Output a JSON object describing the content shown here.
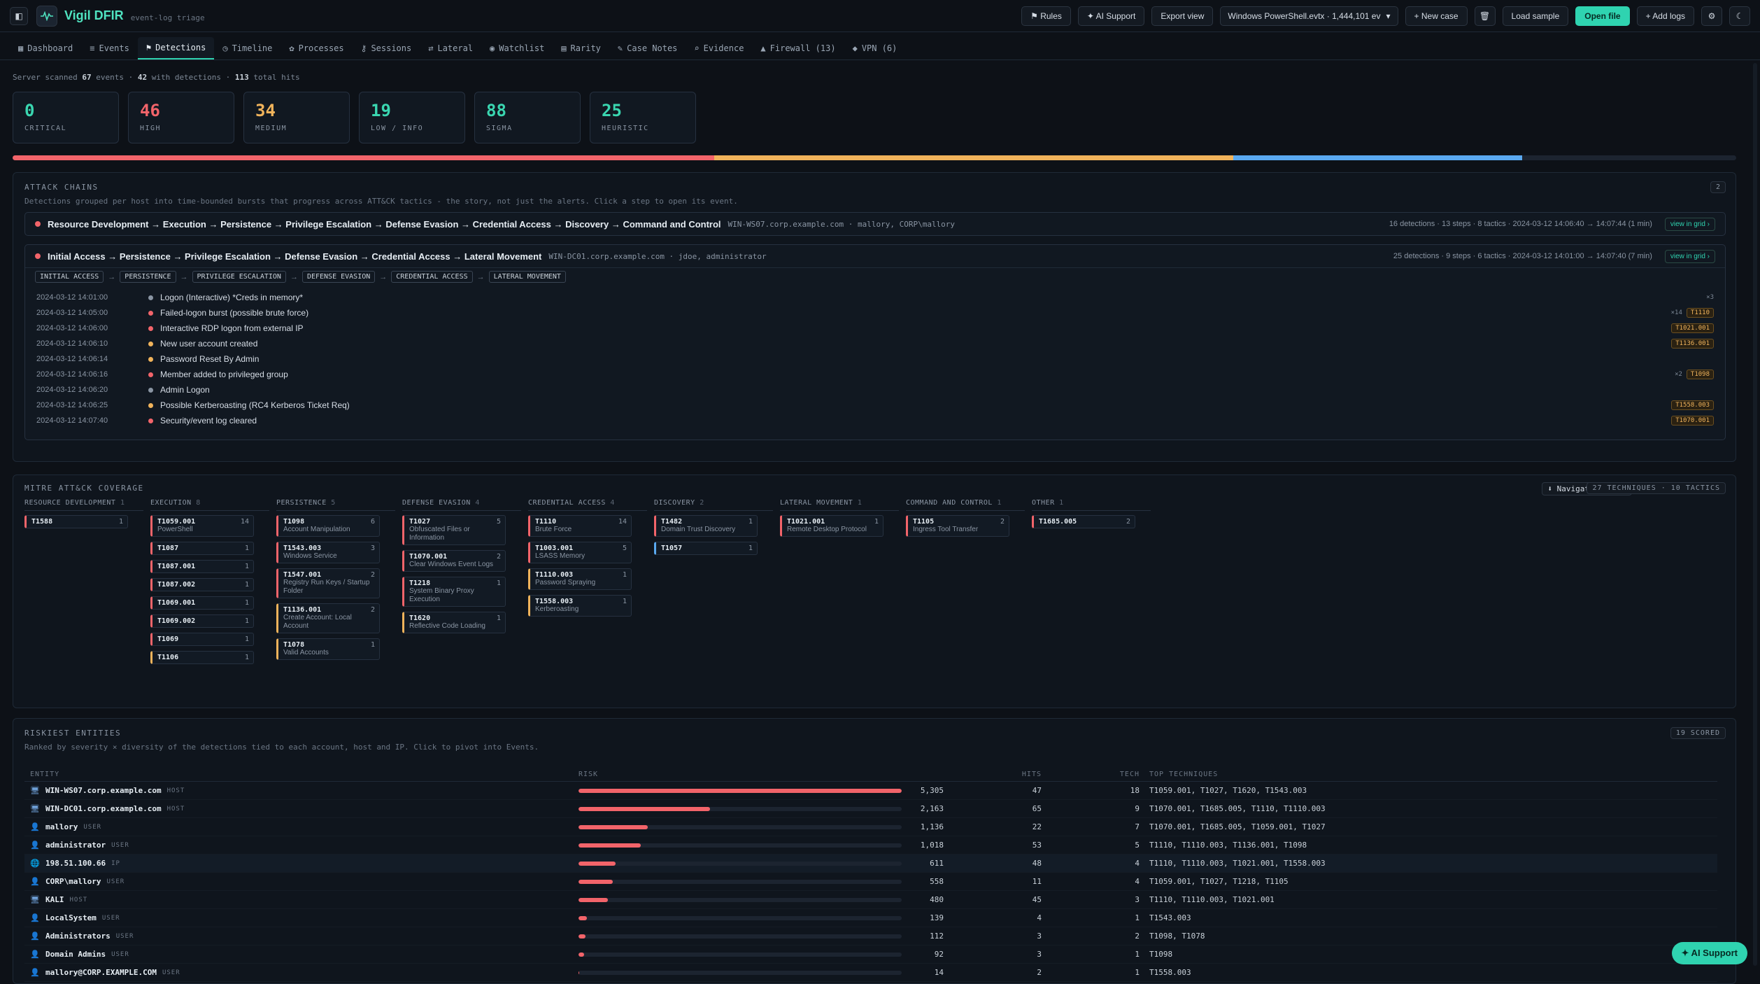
{
  "app": {
    "title": "Vigil DFIR",
    "subtitle": "event-log triage"
  },
  "toolbar": {
    "rules": "⚑ Rules",
    "ai_support": "✦ AI Support",
    "export": "Export view",
    "file": "Windows PowerShell.evtx · 1,444,101 ev",
    "new_case": "+ New case",
    "load_sample": "Load sample",
    "open_file": "Open file",
    "add_logs": "+ Add logs"
  },
  "tabs": [
    {
      "icon": "▦",
      "label": "Dashboard"
    },
    {
      "icon": "≡",
      "label": "Events"
    },
    {
      "icon": "⚑",
      "label": "Detections"
    },
    {
      "icon": "◷",
      "label": "Timeline"
    },
    {
      "icon": "✿",
      "label": "Processes"
    },
    {
      "icon": "⚷",
      "label": "Sessions"
    },
    {
      "icon": "⇄",
      "label": "Lateral"
    },
    {
      "icon": "◉",
      "label": "Watchlist"
    },
    {
      "icon": "▤",
      "label": "Rarity"
    },
    {
      "icon": "✎",
      "label": "Case Notes"
    },
    {
      "icon": "⌕",
      "label": "Evidence"
    },
    {
      "icon": "▲",
      "label": "Firewall (13)"
    },
    {
      "icon": "◆",
      "label": "VPN (6)"
    }
  ],
  "scanned": {
    "prefix": "Server scanned",
    "events": "67",
    "mid": "events · ",
    "with_det": "42",
    "mid2": "with detections · ",
    "hits": "113",
    "suffix": "total hits"
  },
  "stats": [
    {
      "num": "0",
      "label": "CRITICAL",
      "color": "#3ad6b0"
    },
    {
      "num": "46",
      "label": "HIGH",
      "color": "#f2646a"
    },
    {
      "num": "34",
      "label": "MEDIUM",
      "color": "#f0b35b"
    },
    {
      "num": "19",
      "label": "LOW / INFO",
      "color": "#3ad6b0"
    },
    {
      "num": "88",
      "label": "SIGMA",
      "color": "#3ad6b0"
    },
    {
      "num": "25",
      "label": "HEURISTIC",
      "color": "#3ad6b0"
    }
  ],
  "severity_bar": [
    {
      "name": "high",
      "fraction": 0.407,
      "color": "#f2646a"
    },
    {
      "name": "medium",
      "fraction": 0.301,
      "color": "#f0b35b"
    },
    {
      "name": "low",
      "fraction": 0.168,
      "color": "#5aa9f0"
    }
  ],
  "chains": {
    "title": "ATTACK CHAINS",
    "desc": "Detections grouped per host into time-bounded bursts that progress across ATT&CK tactics - the story, not just the alerts. Click a step to open its event.",
    "count": "2",
    "items": [
      {
        "title": "Resource Development → Execution → Persistence → Privilege Escalation → Defense Evasion → Credential Access → Discovery → Command and Control",
        "host": "WIN-WS07.corp.example.com · mallory, CORP\\mallory",
        "meta": "16 detections · 13 steps · 8 tactics · 2024-03-12 14:06:40 → 14:07:44 (1 min)",
        "btn": "view in grid ›"
      },
      {
        "title": "Initial Access → Persistence → Privilege Escalation → Defense Evasion → Credential Access → Lateral Movement",
        "host": "WIN-DC01.corp.example.com · jdoe, administrator",
        "meta": "25 detections · 9 steps · 6 tactics · 2024-03-12 14:01:00 → 14:07:40 (7 min)",
        "btn": "view in grid ›",
        "tactics": [
          "INITIAL ACCESS",
          "PERSISTENCE",
          "PRIVILEGE ESCALATION",
          "DEFENSE EVASION",
          "CREDENTIAL ACCESS",
          "LATERAL MOVEMENT"
        ],
        "steps": [
          {
            "ts": "2024-03-12 14:01:00",
            "name": "Logon (Interactive) *Creds in memory*",
            "color": "#8a95a3",
            "count": "×3",
            "tid": ""
          },
          {
            "ts": "2024-03-12 14:05:00",
            "name": "Failed-logon burst (possible brute force)",
            "color": "#f2646a",
            "count": "×14",
            "tid": "T1110"
          },
          {
            "ts": "2024-03-12 14:06:00",
            "name": "Interactive RDP logon from external IP",
            "color": "#f2646a",
            "count": "",
            "tid": "T1021.001"
          },
          {
            "ts": "2024-03-12 14:06:10",
            "name": "New user account created",
            "color": "#f0b35b",
            "count": "",
            "tid": "T1136.001"
          },
          {
            "ts": "2024-03-12 14:06:14",
            "name": "Password Reset By Admin",
            "color": "#f0b35b",
            "count": "",
            "tid": ""
          },
          {
            "ts": "2024-03-12 14:06:16",
            "name": "Member added to privileged group",
            "color": "#f2646a",
            "count": "×2",
            "tid": "T1098"
          },
          {
            "ts": "2024-03-12 14:06:20",
            "name": "Admin Logon",
            "color": "#8a95a3",
            "count": "",
            "tid": ""
          },
          {
            "ts": "2024-03-12 14:06:25",
            "name": "Possible Kerberoasting (RC4 Kerberos Ticket Req)",
            "color": "#f0b35b",
            "count": "",
            "tid": "T1558.003"
          },
          {
            "ts": "2024-03-12 14:07:40",
            "name": "Security/event log cleared",
            "color": "#f2646a",
            "count": "",
            "tid": "T1070.001"
          }
        ]
      }
    ]
  },
  "mitre": {
    "title": "MITRE ATT&CK COVERAGE",
    "nav_btn": "⬇ Navigator layer",
    "summary": "27 TECHNIQUES · 10 TACTICS",
    "columns": [
      {
        "name": "RESOURCE DEVELOPMENT",
        "n": "1",
        "techs": [
          {
            "code": "T1588",
            "name": "",
            "count": "1",
            "sev": "high"
          }
        ]
      },
      {
        "name": "EXECUTION",
        "n": "8",
        "techs": [
          {
            "code": "T1059.001",
            "name": "PowerShell",
            "count": "14",
            "sev": "high"
          },
          {
            "code": "T1087",
            "name": "",
            "count": "1",
            "sev": "high"
          },
          {
            "code": "T1087.001",
            "name": "",
            "count": "1",
            "sev": "high"
          },
          {
            "code": "T1087.002",
            "name": "",
            "count": "1",
            "sev": "high"
          },
          {
            "code": "T1069.001",
            "name": "",
            "count": "1",
            "sev": "high"
          },
          {
            "code": "T1069.002",
            "name": "",
            "count": "1",
            "sev": "high"
          },
          {
            "code": "T1069",
            "name": "",
            "count": "1",
            "sev": "high"
          },
          {
            "code": "T1106",
            "name": "",
            "count": "1",
            "sev": "med"
          }
        ]
      },
      {
        "name": "PERSISTENCE",
        "n": "5",
        "techs": [
          {
            "code": "T1098",
            "name": "Account Manipulation",
            "count": "6",
            "sev": "high"
          },
          {
            "code": "T1543.003",
            "name": "Windows Service",
            "count": "3",
            "sev": "high"
          },
          {
            "code": "T1547.001",
            "name": "Registry Run Keys / Startup Folder",
            "count": "2",
            "sev": "high"
          },
          {
            "code": "T1136.001",
            "name": "Create Account: Local Account",
            "count": "2",
            "sev": "med"
          },
          {
            "code": "T1078",
            "name": "Valid Accounts",
            "count": "1",
            "sev": "med"
          }
        ]
      },
      {
        "name": "DEFENSE EVASION",
        "n": "4",
        "techs": [
          {
            "code": "T1027",
            "name": "Obfuscated Files or Information",
            "count": "5",
            "sev": "high"
          },
          {
            "code": "T1070.001",
            "name": "Clear Windows Event Logs",
            "count": "2",
            "sev": "high"
          },
          {
            "code": "T1218",
            "name": "System Binary Proxy Execution",
            "count": "1",
            "sev": "high"
          },
          {
            "code": "T1620",
            "name": "Reflective Code Loading",
            "count": "1",
            "sev": "med"
          }
        ]
      },
      {
        "name": "CREDENTIAL ACCESS",
        "n": "4",
        "techs": [
          {
            "code": "T1110",
            "name": "Brute Force",
            "count": "14",
            "sev": "high"
          },
          {
            "code": "T1003.001",
            "name": "LSASS Memory",
            "count": "5",
            "sev": "high"
          },
          {
            "code": "T1110.003",
            "name": "Password Spraying",
            "count": "1",
            "sev": "med"
          },
          {
            "code": "T1558.003",
            "name": "Kerberoasting",
            "count": "1",
            "sev": "med"
          }
        ]
      },
      {
        "name": "DISCOVERY",
        "n": "2",
        "techs": [
          {
            "code": "T1482",
            "name": "Domain Trust Discovery",
            "count": "1",
            "sev": "high"
          },
          {
            "code": "T1057",
            "name": "",
            "count": "1",
            "sev": "low"
          }
        ]
      },
      {
        "name": "LATERAL MOVEMENT",
        "n": "1",
        "techs": [
          {
            "code": "T1021.001",
            "name": "Remote Desktop Protocol",
            "count": "1",
            "sev": "high"
          }
        ]
      },
      {
        "name": "COMMAND AND CONTROL",
        "n": "1",
        "techs": [
          {
            "code": "T1105",
            "name": "Ingress Tool Transfer",
            "count": "2",
            "sev": "high"
          }
        ]
      },
      {
        "name": "OTHER",
        "n": "1",
        "techs": [
          {
            "code": "T1685.005",
            "name": "",
            "count": "2",
            "sev": "high"
          }
        ]
      }
    ]
  },
  "entities": {
    "title": "RISKIEST ENTITIES",
    "desc": "Ranked by severity × diversity of the detections tied to each account, host and IP. Click to pivot into Events.",
    "count": "19 SCORED",
    "headers": {
      "entity": "ENTITY",
      "risk": "RISK",
      "hits": "HITS",
      "tech": "TECH",
      "top": "TOP TECHNIQUES"
    },
    "max_score": 5305,
    "rows": [
      {
        "icon": "host",
        "name": "WIN-WS07.corp.example.com",
        "kind": "HOST",
        "score": 5305,
        "score_text": "5,305",
        "hits": "47",
        "tech": "18",
        "top": "T1059.001, T1027, T1620, T1543.003"
      },
      {
        "icon": "host",
        "name": "WIN-DC01.corp.example.com",
        "kind": "HOST",
        "score": 2163,
        "score_text": "2,163",
        "hits": "65",
        "tech": "9",
        "top": "T1070.001, T1685.005, T1110, T1110.003"
      },
      {
        "icon": "user",
        "name": "mallory",
        "kind": "USER",
        "score": 1136,
        "score_text": "1,136",
        "hits": "22",
        "tech": "7",
        "top": "T1070.001, T1685.005, T1059.001, T1027"
      },
      {
        "icon": "user",
        "name": "administrator",
        "kind": "USER",
        "score": 1018,
        "score_text": "1,018",
        "hits": "53",
        "tech": "5",
        "top": "T1110, T1110.003, T1136.001, T1098"
      },
      {
        "icon": "ip",
        "name": "198.51.100.66",
        "kind": "IP",
        "score": 611,
        "score_text": "611",
        "hits": "48",
        "tech": "4",
        "top": "T1110, T1110.003, T1021.001, T1558.003",
        "hl": true
      },
      {
        "icon": "user",
        "name": "CORP\\mallory",
        "kind": "USER",
        "score": 558,
        "score_text": "558",
        "hits": "11",
        "tech": "4",
        "top": "T1059.001, T1027, T1218, T1105"
      },
      {
        "icon": "host",
        "name": "KALI",
        "kind": "HOST",
        "score": 480,
        "score_text": "480",
        "hits": "45",
        "tech": "3",
        "top": "T1110, T1110.003, T1021.001"
      },
      {
        "icon": "user",
        "name": "LocalSystem",
        "kind": "USER",
        "score": 139,
        "score_text": "139",
        "hits": "4",
        "tech": "1",
        "top": "T1543.003"
      },
      {
        "icon": "user",
        "name": "Administrators",
        "kind": "USER",
        "score": 112,
        "score_text": "112",
        "hits": "3",
        "tech": "2",
        "top": "T1098, T1078"
      },
      {
        "icon": "user",
        "name": "Domain Admins",
        "kind": "USER",
        "score": 92,
        "score_text": "92",
        "hits": "3",
        "tech": "1",
        "top": "T1098"
      },
      {
        "icon": "user",
        "name": "mallory@CORP.EXAMPLE.COM",
        "kind": "USER",
        "score": 14,
        "score_text": "14",
        "hits": "2",
        "tech": "1",
        "top": "T1558.003"
      }
    ]
  },
  "float_ai": "✦ AI Support"
}
